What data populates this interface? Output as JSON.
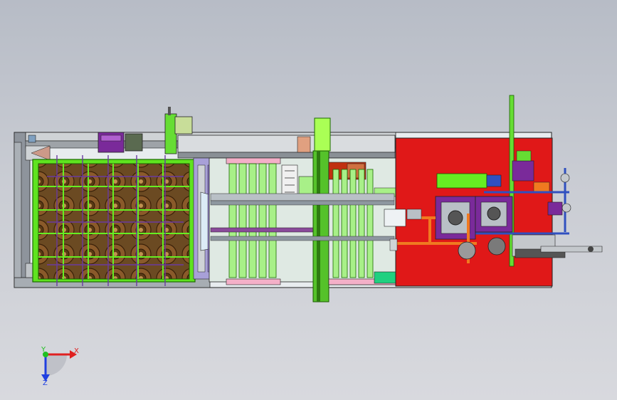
{
  "viewport": {
    "background_top": "#b7bcc6",
    "background_bottom": "#d8d9de"
  },
  "colors": {
    "frame_gray": "#9aa0a8",
    "rail_gray": "#c4c8cc",
    "tray_green": "#66ee22",
    "tray_green_dark": "#3a9a10",
    "coil_brown": "#8a5a2a",
    "coil_dark": "#4a2c10",
    "lime_column": "#aaff55",
    "station_red": "#e01818",
    "pipe_orange": "#f07a20",
    "purple_block": "#7a2a9a",
    "blue_rail": "#3050c0",
    "teal_base": "#20d080",
    "pink_pad": "#f060a0",
    "cyan_pale": "#ccf5f5"
  },
  "icons": {
    "triad": "coordinate-triad-icon"
  },
  "triad": {
    "x_label": "X",
    "y_label": "Y",
    "z_label": "Z",
    "x_color": "#e02020",
    "y_color": "#20c020",
    "z_color": "#2040e0"
  }
}
